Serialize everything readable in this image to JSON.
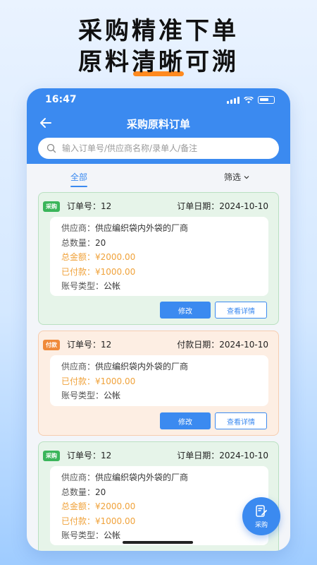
{
  "promo": {
    "line1": "采购精准下单",
    "line2_a": "原料",
    "line2_hl": "清晰",
    "line2_b": "可溯"
  },
  "status": {
    "time": "16:47"
  },
  "header": {
    "title": "采购原料订单"
  },
  "search": {
    "placeholder": "输入订单号/供应商名称/录单人/备注"
  },
  "filters": {
    "tab_all": "全部",
    "filter_label": "筛选"
  },
  "colors": {
    "accent": "#3b8af0",
    "green": "#3ab55a",
    "orange": "#f08a3a",
    "warn_text": "#f0a23a"
  },
  "orders": [
    {
      "badge": "采购",
      "order_no": "订单号：12",
      "date": "订单日期：2024-10-10",
      "supplier_label": "供应商：",
      "supplier": "供应编织袋内外袋的厂商",
      "qty_label": "总数量：",
      "qty": "20",
      "total_label": "总金额：",
      "total": "¥2000.00",
      "paid_label": "已付款：",
      "paid": "¥1000.00",
      "acct_label": "账号类型：",
      "acct": "公帐",
      "edit": "修改",
      "detail": "查看详情"
    },
    {
      "badge": "付款",
      "order_no": "订单号：12",
      "date": "付款日期：2024-10-10",
      "supplier_label": "供应商：",
      "supplier": "供应编织袋内外袋的厂商",
      "paid_label": "已付款：",
      "paid": "¥1000.00",
      "acct_label": "账号类型：",
      "acct": "公帐",
      "edit": "修改",
      "detail": "查看详情"
    },
    {
      "badge": "采购",
      "order_no": "订单号：12",
      "date": "订单日期：2024-10-10",
      "supplier_label": "供应商：",
      "supplier": "供应编织袋内外袋的厂商",
      "qty_label": "总数量：",
      "qty": "20",
      "total_label": "总金额：",
      "total": "¥2000.00",
      "paid_label": "已付款：",
      "paid": "¥1000.00",
      "acct_label": "账号类型：",
      "acct": "公帐"
    }
  ],
  "fab": {
    "label": "采购"
  }
}
